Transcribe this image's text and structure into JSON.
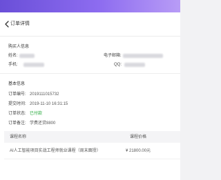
{
  "page": {
    "title": "订单详情"
  },
  "buyer": {
    "section_title": "购买人信息",
    "name_label": "姓名:",
    "email_label": "电子邮箱:",
    "phone_label": "手机:",
    "qq_label": "QQ:"
  },
  "basic": {
    "section_title": "基本信息",
    "order_no_label": "订单编号:",
    "order_no": "2019111015732",
    "submit_time_label": "提交时间:",
    "submit_time": "2019-11-10 16:31:15",
    "status_label": "订单状态:",
    "status": "已付款",
    "remark_label": "订单备注:",
    "remark": "学费还贷8800"
  },
  "table": {
    "columns": [
      "课程名称",
      "课程价格"
    ],
    "rows": [
      {
        "name": "AI人工智能项目实战工程师就业课程（周末面授）",
        "price": "¥ 21800.00元"
      }
    ]
  },
  "colors": {
    "hero_gradient_start": "#6a4fd8",
    "hero_gradient_end": "#b89cf6",
    "status_paid": "#22a838"
  }
}
